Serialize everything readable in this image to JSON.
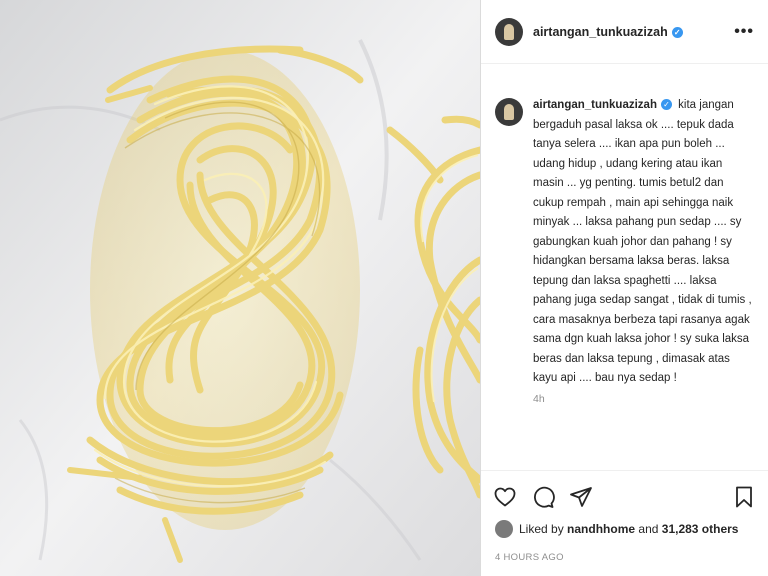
{
  "header": {
    "username": "airtangan_tunkuazizah",
    "verified_icon": "verified-badge-icon",
    "more_icon": "more-options-icon"
  },
  "caption": {
    "username": "airtangan_tunkuazizah",
    "text": "kita jangan bergaduh pasal laksa ok .... tepuk dada tanya selera .... ikan apa pun boleh ... udang hidup , udang kering atau ikan masin ... yg penting. tumis betul2 dan cukup rempah , main api sehingga naik minyak ... laksa pahang pun sedap .... sy gabungkan kuah johor dan pahang ! sy hidangkan bersama laksa beras. laksa tepung dan laksa spaghetti .... laksa pahang juga sedap sangat , tidak di tumis , cara masaknya berbeza tapi rasanya agak sama dgn kuah laksa johor ! sy suka laksa beras dan laksa tepung , dimasak atas kayu api .... bau nya sedap !",
    "time": "4h"
  },
  "actions": {
    "like_icon": "heart-icon",
    "comment_icon": "comment-icon",
    "share_icon": "share-icon",
    "save_icon": "bookmark-icon"
  },
  "likes": {
    "prefix": "Liked by ",
    "user": "nandhhome",
    "middle": " and ",
    "count": "31,283 others"
  },
  "posted_ago": "4 HOURS AGO",
  "colors": {
    "verified": "#3897f0",
    "noodle": "#f2e08a",
    "noodle_shadow": "#c9ad4a",
    "cloth": "#e9e9ea"
  }
}
